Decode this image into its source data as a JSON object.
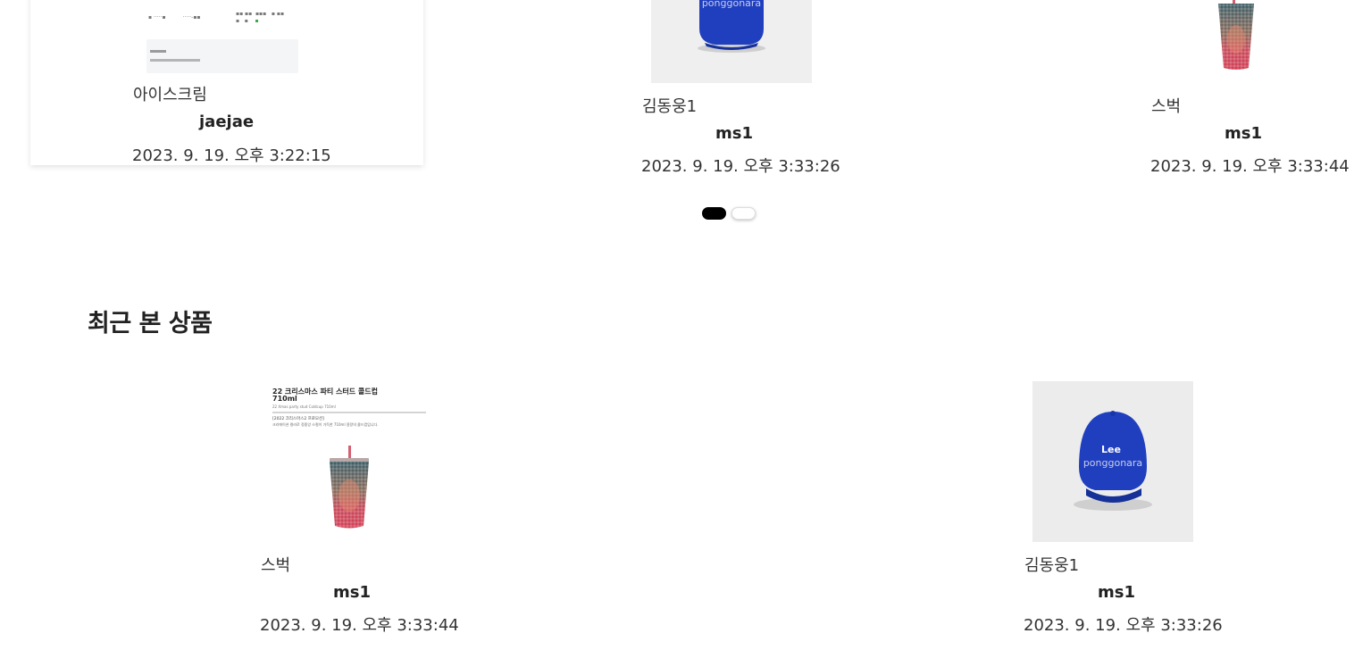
{
  "carousel": {
    "cards": [
      {
        "title": "아이스크림",
        "author": "jaejae",
        "date": "2023. 9. 19. 오후 3:22:15",
        "image": "document-image"
      },
      {
        "title": "김동웅1",
        "author": "ms1",
        "date": "2023. 9. 19. 오후 3:33:26",
        "image": "blue-cap-image",
        "watermark": "ponggonara"
      },
      {
        "title": "스벅",
        "author": "ms1",
        "date": "2023. 9. 19. 오후 3:33:44",
        "image": "tumbler-image"
      }
    ],
    "pagination": {
      "count": 2,
      "active_index": 0
    }
  },
  "recent": {
    "heading": "최근 본 상품",
    "cards": [
      {
        "title": "스벅",
        "author": "ms1",
        "date": "2023. 9. 19. 오후 3:33:44",
        "image": "tumbler-image",
        "image_text": {
          "headline": "22 크리스마스 파티 스터드 콜드컵",
          "size": "710ml",
          "sub": "22 Xmas party stud Coldcup 710ml",
          "note_title": "[2022 크리스마스2 프로모션]",
          "note_body": "크리에이션 컬러로 정중앙 스컬이 가득한 710ml 용량의 콜드컵입니다."
        }
      },
      {
        "title": "김동웅1",
        "author": "ms1",
        "date": "2023. 9. 19. 오후 3:33:26",
        "image": "blue-cap-image",
        "cap_logo": "Lee",
        "watermark": "ponggonara"
      }
    ]
  },
  "colors": {
    "cap_blue": "#1f3fbf",
    "pagination_active": "#000000",
    "pagination_inactive": "#ffffff"
  }
}
